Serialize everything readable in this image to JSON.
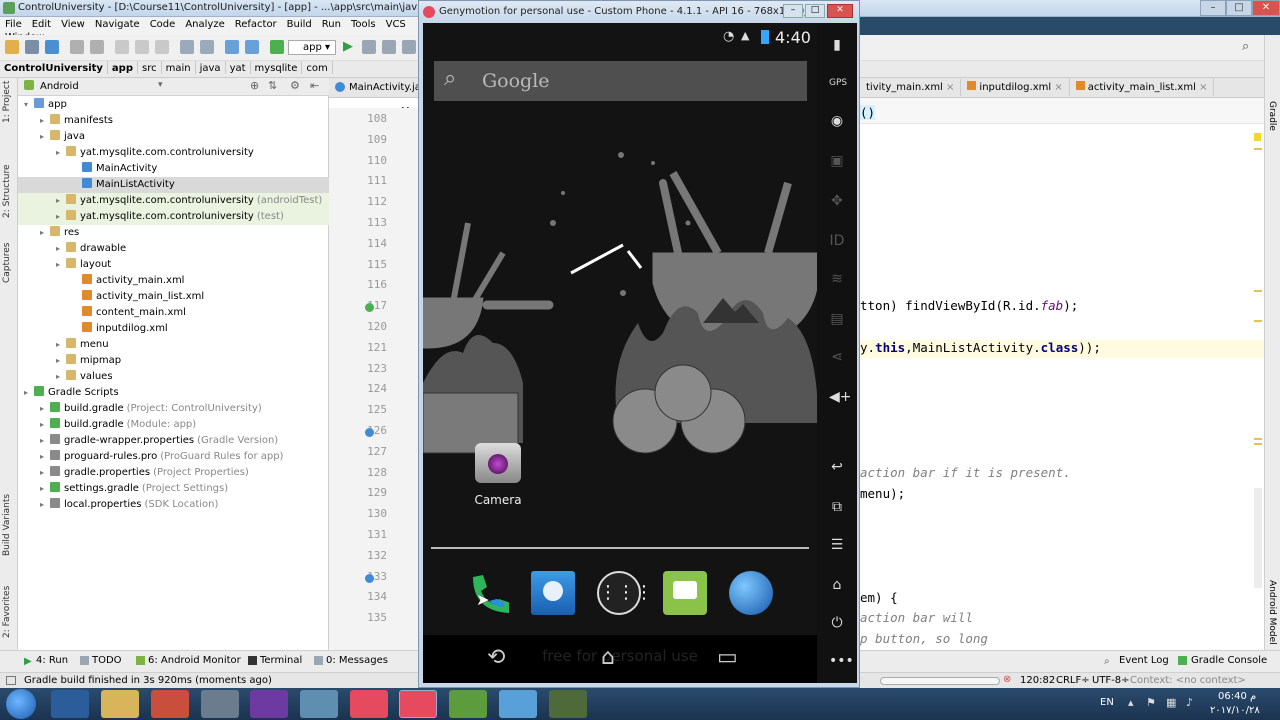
{
  "ide": {
    "title": "ControlUniversity - [D:\\Course11\\ControlUniversity] - [app] - ...\\app\\src\\main\\java\\yat\\mysqlite",
    "menu": [
      "File",
      "Edit",
      "View",
      "Navigate",
      "Code",
      "Analyze",
      "Refactor",
      "Build",
      "Run",
      "Tools",
      "VCS",
      "Window"
    ],
    "run_config": "app",
    "breadcrumb": [
      "ControlUniversity",
      "app",
      "src",
      "main",
      "java",
      "yat",
      "mysqlite",
      "com"
    ],
    "project_view": "Android",
    "editor_tab": "MainActivity.java",
    "editor_tab2_fragment": "Ma",
    "right_tabs": [
      "tivity_main.xml",
      "inputdilog.xml",
      "activity_main_list.xml"
    ],
    "tree": [
      {
        "label": "app",
        "depth": 0,
        "icon": "app-folder-icon",
        "color": "#6a9bd8"
      },
      {
        "label": "manifests",
        "depth": 1,
        "icon": "folder-icon",
        "color": "#d9b76a"
      },
      {
        "label": "java",
        "depth": 1,
        "icon": "folder-icon",
        "color": "#d9b76a"
      },
      {
        "label": "yat.mysqlite.com.controluniversity",
        "depth": 2,
        "icon": "package-icon",
        "color": "#d9b76a"
      },
      {
        "label": "MainActivity",
        "depth": 3,
        "icon": "class-icon",
        "color": "#3f8bd5"
      },
      {
        "label": "MainListActivity",
        "depth": 3,
        "icon": "class-icon",
        "color": "#3f8bd5",
        "selected": true
      },
      {
        "label": "yat.mysqlite.com.controluniversity",
        "sub": "(androidTest)",
        "depth": 2,
        "icon": "package-icon",
        "color": "#d9b76a",
        "test": true
      },
      {
        "label": "yat.mysqlite.com.controluniversity",
        "sub": "(test)",
        "depth": 2,
        "icon": "package-icon",
        "color": "#d9b76a",
        "test": true
      },
      {
        "label": "res",
        "depth": 1,
        "icon": "folder-icon",
        "color": "#d9b76a"
      },
      {
        "label": "drawable",
        "depth": 2,
        "icon": "folder-icon",
        "color": "#d9b76a"
      },
      {
        "label": "layout",
        "depth": 2,
        "icon": "folder-icon",
        "color": "#d9b76a"
      },
      {
        "label": "activity_main.xml",
        "depth": 3,
        "icon": "xml-icon",
        "color": "#e08a2c"
      },
      {
        "label": "activity_main_list.xml",
        "depth": 3,
        "icon": "xml-icon",
        "color": "#e08a2c"
      },
      {
        "label": "content_main.xml",
        "depth": 3,
        "icon": "xml-icon",
        "color": "#e08a2c"
      },
      {
        "label": "inputdilog.xml",
        "depth": 3,
        "icon": "xml-icon",
        "color": "#e08a2c"
      },
      {
        "label": "menu",
        "depth": 2,
        "icon": "folder-icon",
        "color": "#d9b76a"
      },
      {
        "label": "mipmap",
        "depth": 2,
        "icon": "folder-icon",
        "color": "#d9b76a"
      },
      {
        "label": "values",
        "depth": 2,
        "icon": "folder-icon",
        "color": "#d9b76a"
      },
      {
        "label": "Gradle Scripts",
        "depth": 0,
        "icon": "gradle-icon",
        "color": "#4caf50"
      },
      {
        "label": "build.gradle",
        "sub": "(Project: ControlUniversity)",
        "depth": 1,
        "icon": "gradle-icon",
        "color": "#4caf50"
      },
      {
        "label": "build.gradle",
        "sub": "(Module: app)",
        "depth": 1,
        "icon": "gradle-icon",
        "color": "#4caf50"
      },
      {
        "label": "gradle-wrapper.properties",
        "sub": "(Gradle Version)",
        "depth": 1,
        "icon": "properties-icon",
        "color": "#8a8a8a"
      },
      {
        "label": "proguard-rules.pro",
        "sub": "(ProGuard Rules for app)",
        "depth": 1,
        "icon": "file-icon",
        "color": "#8a8a8a"
      },
      {
        "label": "gradle.properties",
        "sub": "(Project Properties)",
        "depth": 1,
        "icon": "properties-icon",
        "color": "#8a8a8a"
      },
      {
        "label": "settings.gradle",
        "sub": "(Project Settings)",
        "depth": 1,
        "icon": "gradle-icon",
        "color": "#4caf50"
      },
      {
        "label": "local.properties",
        "sub": "(SDK Location)",
        "depth": 1,
        "icon": "properties-icon",
        "color": "#8a8a8a"
      }
    ],
    "line_numbers": [
      "108",
      "109",
      "110",
      "111",
      "112",
      "113",
      "114",
      "115",
      "116",
      "117",
      "120",
      "121",
      "123",
      "124",
      "125",
      "126",
      "127",
      "128",
      "129",
      "130",
      "131",
      "132",
      "133",
      "134",
      "135"
    ],
    "code_lines": [
      {
        "row": 1,
        "text": "()"
      },
      {
        "row": 10,
        "text": "tton) findViewById(R.id.",
        "it": "fab",
        "tail": ");"
      },
      {
        "row": 12,
        "pre": "y.",
        "kw": "this",
        "mid": ",MainListActivity.",
        "kw2": "class",
        "tail": "));"
      },
      {
        "row": 18,
        "cm": "action bar if it is present."
      },
      {
        "row": 19,
        "text": "menu);"
      },
      {
        "row": 24,
        "text": "em) {"
      },
      {
        "row": 25,
        "cm": "action bar will"
      },
      {
        "row": 26,
        "cm": "p button, so long"
      }
    ],
    "left_strip": [
      "1: Project",
      "2: Structure",
      "Captures",
      "Build Variants",
      "2: Favorites"
    ],
    "right_strip": [
      "Gradle",
      "Android Model"
    ],
    "bottom_tabs": [
      "4: Run",
      "TODO",
      "6: Android Monitor",
      "Terminal",
      "0: Messages",
      "Event Log",
      "Gradle Console"
    ],
    "status_message": "Gradle build finished in 3s 920ms (moments ago)",
    "status_right": [
      "120:82",
      "CRLF÷",
      "UTF-8÷",
      "Context: <no context>"
    ]
  },
  "emulator": {
    "title": "Genymotion for personal use - Custom Phone - 4.1.1 - API 16 - 768x1280_1 (...",
    "time": "4:40",
    "search_placeholder": "Google",
    "app_label": "Camera",
    "watermark": "free for personal use",
    "dock": [
      "phone-icon",
      "contacts-icon",
      "app-drawer-icon",
      "messaging-icon",
      "browser-icon"
    ],
    "sidebar": [
      "battery-icon",
      "gps-icon",
      "camera-icon",
      "video-icon",
      "remote-icon",
      "id-icon",
      "rss-icon",
      "sms-icon",
      "share-icon",
      "volume-up-icon",
      "back-icon",
      "recent-icon",
      "menu-icon",
      "home-icon",
      "power-icon",
      "more-icon"
    ]
  },
  "taskbar": {
    "lang": "EN",
    "clock_time": "06:40 م",
    "clock_date": "٢٠١٧/١٠/٢٨"
  },
  "colors": {
    "accent": "#4c8ad8",
    "taskbar": "#1f3a5a",
    "wallpaper": "#202020"
  }
}
